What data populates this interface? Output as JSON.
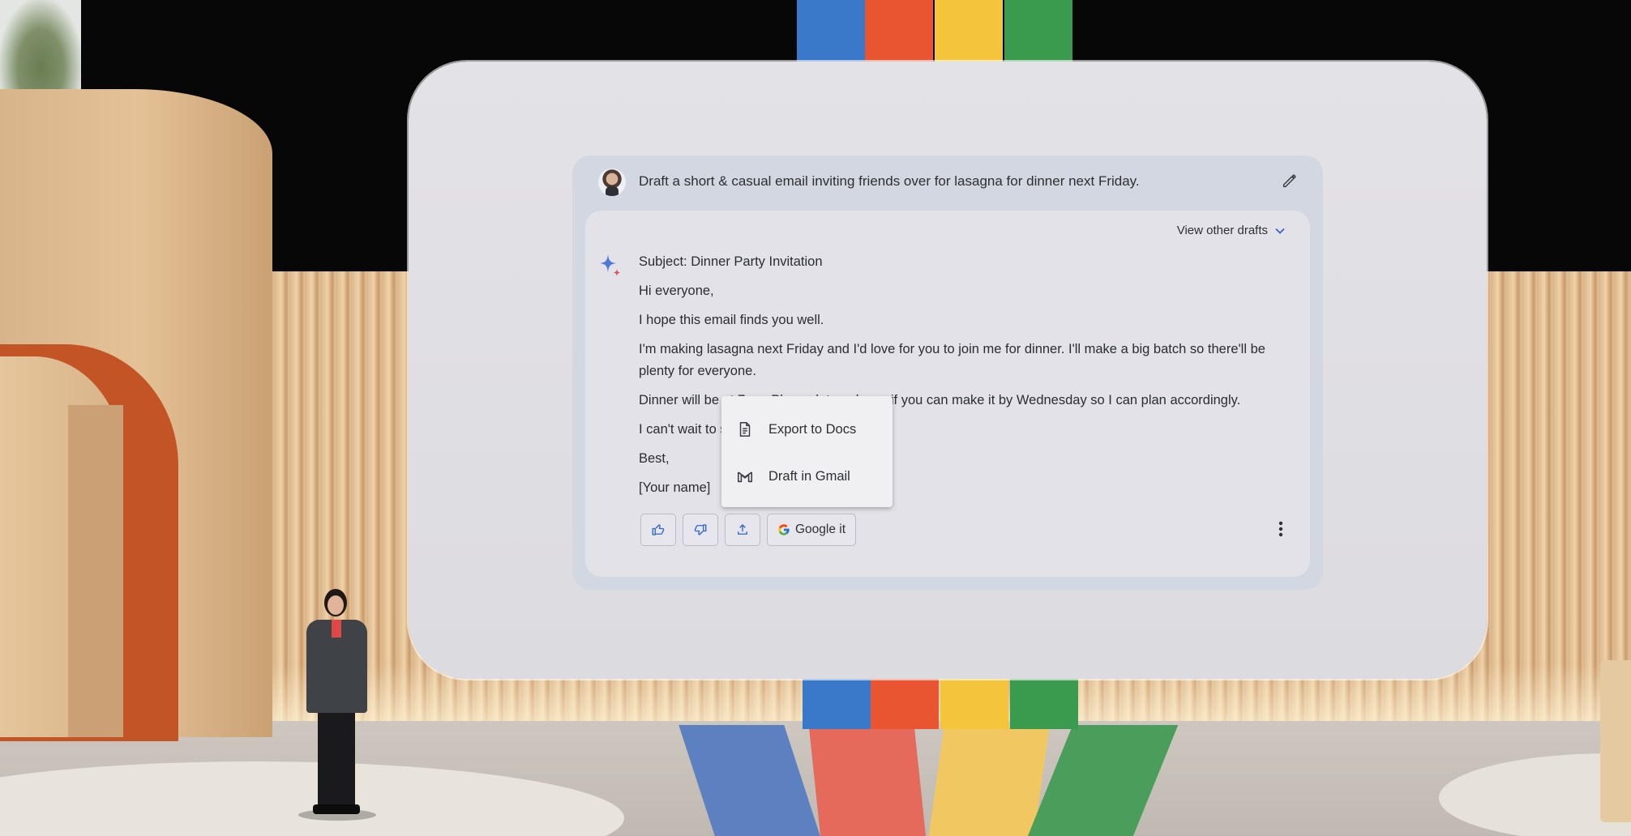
{
  "prompt": {
    "text": "Draft a short & casual email inviting friends over for lasagna for dinner next Friday."
  },
  "response": {
    "view_other_drafts": "View other drafts",
    "subject": "Subject: Dinner Party Invitation",
    "paragraphs": [
      "Hi everyone,",
      "I hope this email finds you well.",
      "I'm making lasagna next Friday and I'd love for you to join me for dinner. I'll make a big batch so there'll be plenty for everyone.",
      "Dinner will be at 7pm. Please let me know if you can make it by Wednesday so I can plan accordingly.",
      "I can't wait to see you all!",
      "Best,",
      "[Your name]"
    ]
  },
  "actions": {
    "google_it": "Google it",
    "icons": [
      "thumbs-up-icon",
      "thumbs-down-icon",
      "share-icon",
      "google-icon",
      "more-vert-icon"
    ]
  },
  "export_menu": {
    "items": [
      {
        "label": "Export to Docs",
        "icon": "docs-icon"
      },
      {
        "label": "Draft in Gmail",
        "icon": "gmail-icon"
      }
    ]
  },
  "colors": {
    "accent_blue": "#1a73e8",
    "sparkle_blue": "#4e78d6",
    "sparkle_red": "#d55a60",
    "panel_bg": "#d3d7e2",
    "response_bg": "#e2e2e8"
  }
}
